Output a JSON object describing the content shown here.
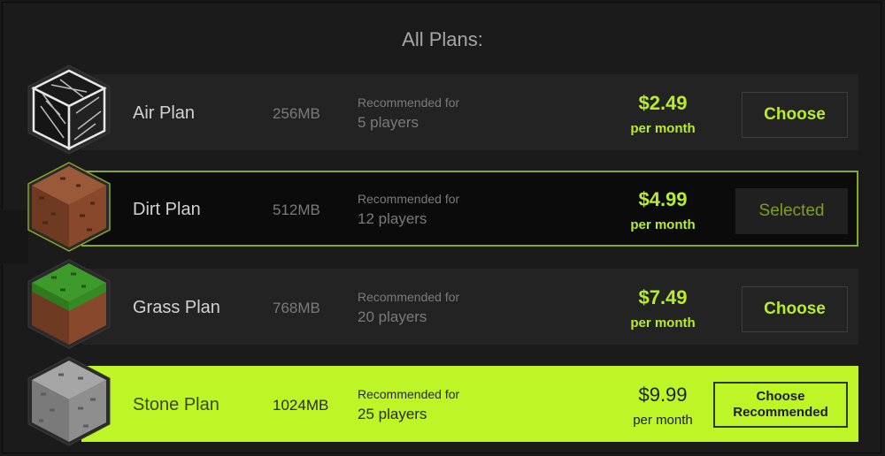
{
  "header": {
    "title": "All Plans:"
  },
  "plans": [
    {
      "name": "Air Plan",
      "memory": "256MB",
      "recommended_for": "Recommended for",
      "players": "5 players",
      "price": "$2.49",
      "period": "per month",
      "button": "Choose",
      "icon": "air-block-icon"
    },
    {
      "name": "Dirt Plan",
      "memory": "512MB",
      "recommended_for": "Recommended for",
      "players": "12 players",
      "price": "$4.99",
      "period": "per month",
      "button": "Selected",
      "icon": "dirt-block-icon"
    },
    {
      "name": "Grass Plan",
      "memory": "768MB",
      "recommended_for": "Recommended for",
      "players": "20 players",
      "price": "$7.49",
      "period": "per month",
      "button": "Choose",
      "icon": "grass-block-icon"
    },
    {
      "name": "Stone Plan",
      "memory": "1024MB",
      "recommended_for": "Recommended for",
      "players": "25 players",
      "price": "$9.99",
      "period": "per month",
      "button_line1": "Choose",
      "button_line2": "Recommended",
      "icon": "stone-block-icon"
    }
  ],
  "colors": {
    "accent": "#b8ed28",
    "recommended_bg": "#bdf526",
    "row_bg": "#232323",
    "page_bg": "#191919"
  }
}
